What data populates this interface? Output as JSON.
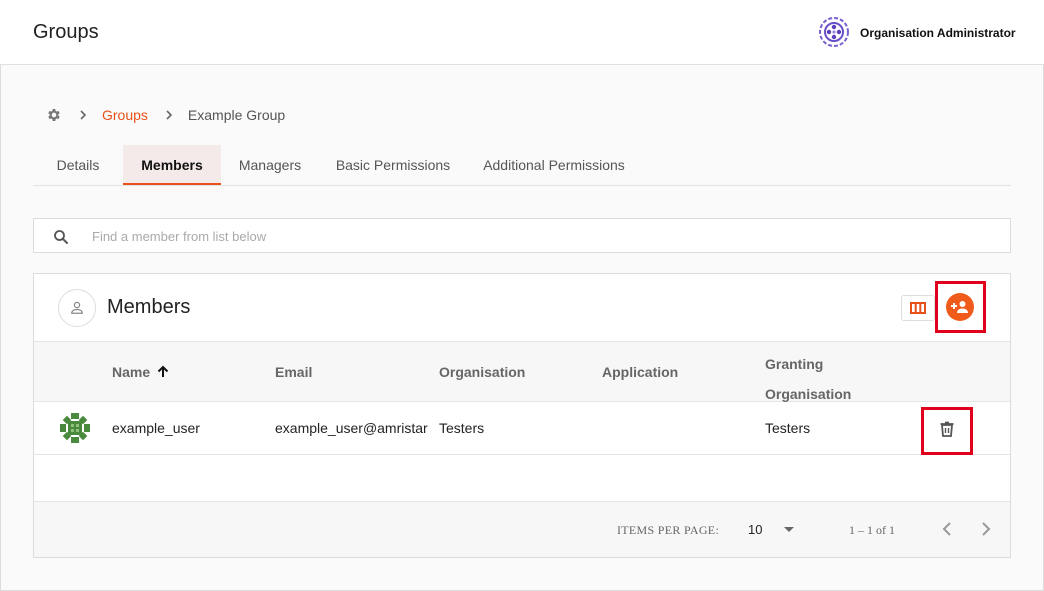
{
  "header": {
    "title": "Groups",
    "org_name": "Organisation Administrator"
  },
  "breadcrumb": {
    "root_icon": "gear-icon",
    "items": [
      "Groups",
      "Example Group"
    ]
  },
  "tabs": [
    {
      "label": "Details",
      "active": false
    },
    {
      "label": "Members",
      "active": true
    },
    {
      "label": "Managers",
      "active": false
    },
    {
      "label": "Basic Permissions",
      "active": false
    },
    {
      "label": "Additional Permissions",
      "active": false
    }
  ],
  "search": {
    "placeholder": "Find a member from list below",
    "value": ""
  },
  "members_card": {
    "title": "Members",
    "columns": [
      "Name",
      "Email",
      "Organisation",
      "Application",
      "Granting Organisation"
    ],
    "granting_line1": "Granting",
    "granting_line2": "Organisation",
    "rows": [
      {
        "name": "example_user",
        "email": "example_user@amristar",
        "organisation": "Testers",
        "application": "",
        "granting_organisation": "Testers"
      }
    ]
  },
  "pagination": {
    "items_per_page_label": "ITEMS PER PAGE:",
    "items_per_page": "10",
    "range": "1 – 1 of 1"
  },
  "colors": {
    "accent": "#e8501a",
    "add_button": "#f05a1a",
    "highlight": "#e0001b",
    "avatar_green": "#4a8a3c"
  }
}
